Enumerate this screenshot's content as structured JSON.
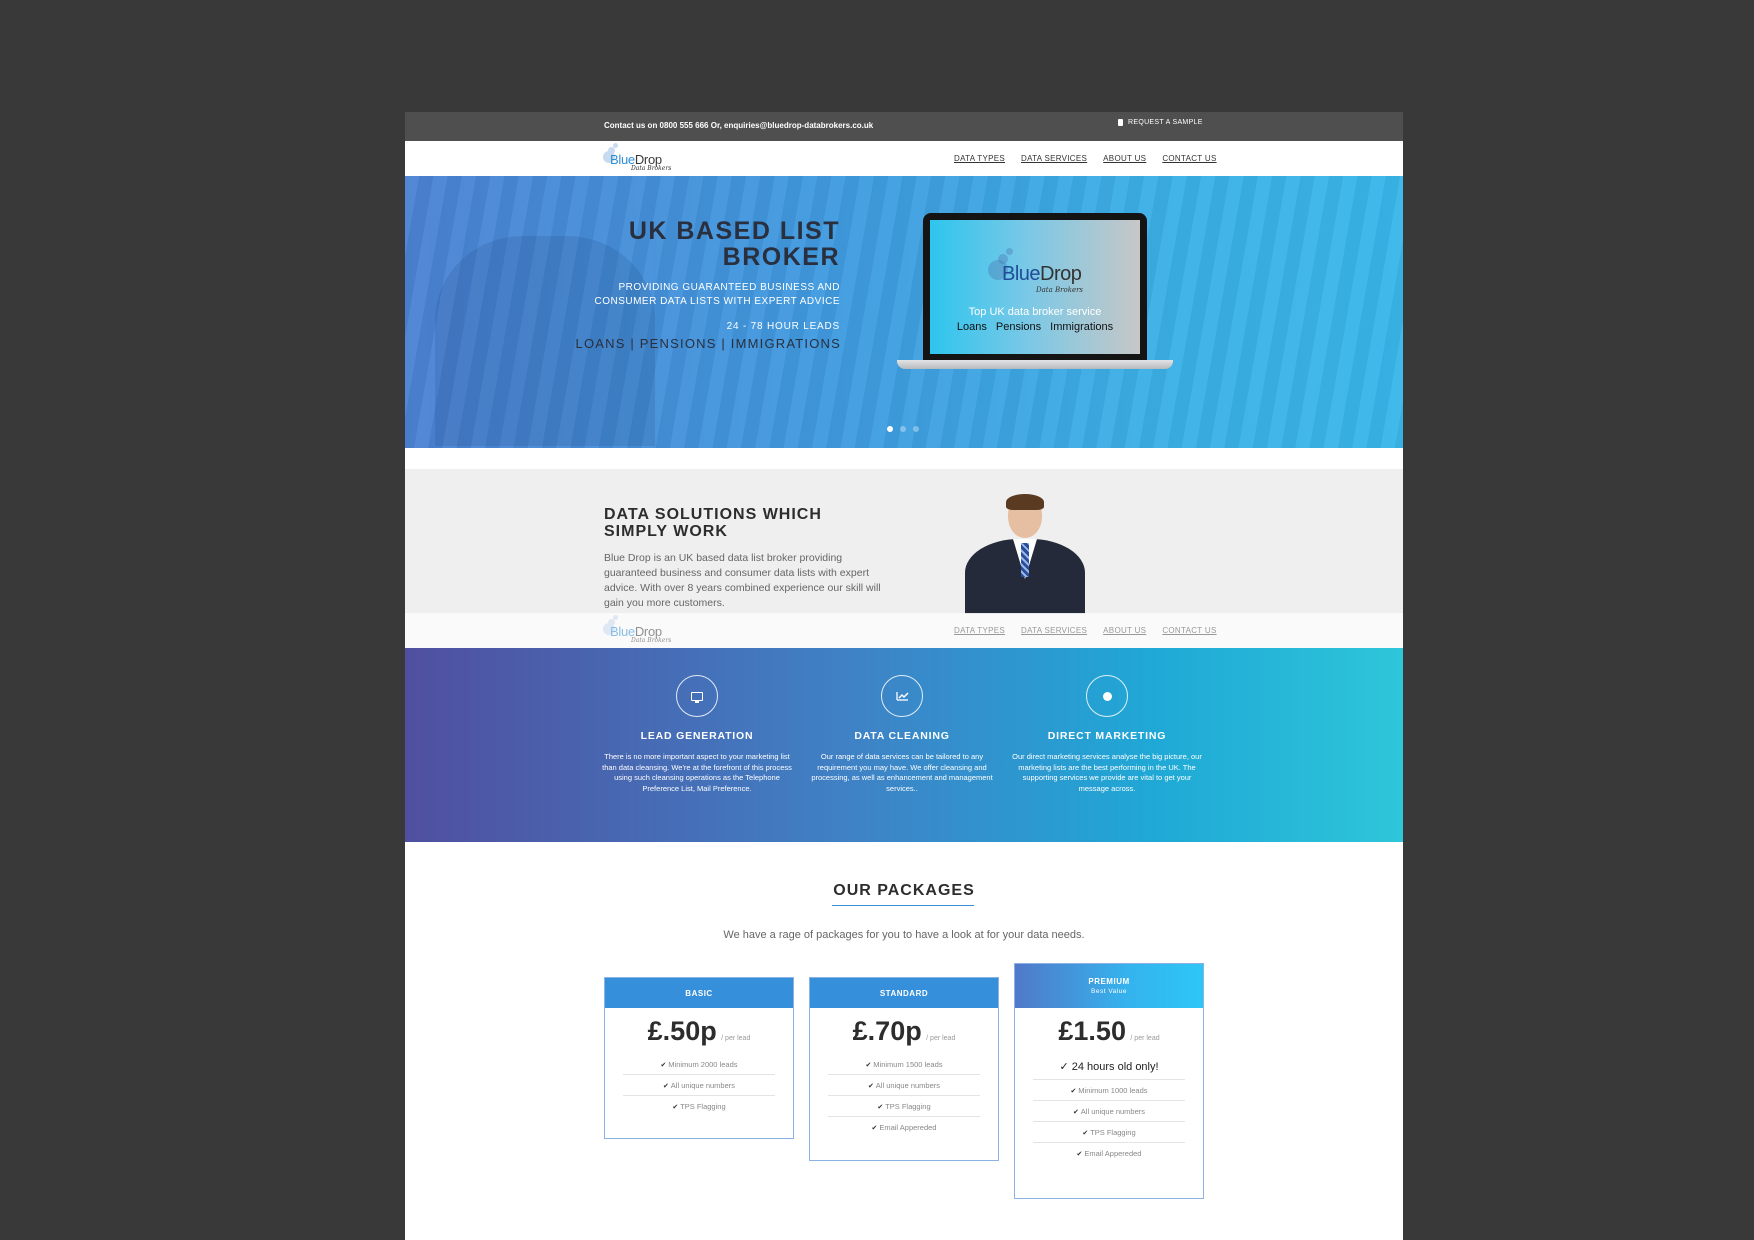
{
  "topbar": {
    "contact": "Contact us on 0800 555 666 Or, enquiries@bluedrop-databrokers.co.uk",
    "sample": "REQUEST A SAMPLE"
  },
  "brand": {
    "blue": "Blue",
    "drop": "Drop",
    "tagline": "Data Brokers"
  },
  "nav": {
    "items": [
      "DATA TYPES",
      "DATA SERVICES",
      "ABOUT US",
      "CONTACT US"
    ]
  },
  "hero": {
    "title": "UK BASED LIST BROKER",
    "subtitle": "PROVIDING GUARANTEED BUSINESS AND CONSUMER DATA LISTS WITH EXPERT ADVICE",
    "leads": "24 - 78 HOUR LEADS",
    "tags": "LOANS | PENSIONS | IMMIGRATIONS",
    "screen_tagline": "Top UK data broker service",
    "screen_products": "Loans  Pensions  Immigrations",
    "slide_count": 3,
    "active_slide": 1
  },
  "about": {
    "title": "DATA SOLUTIONS WHICH SIMPLY WORK",
    "body": "Blue Drop is an UK based data list broker providing guaranteed business and consumer data lists with expert advice. With over 8 years combined experience our skill will gain you more customers."
  },
  "services": [
    {
      "icon": "monitor-icon",
      "title": "LEAD GENERATION",
      "text": "There is no more important aspect to your marketing list than data cleansing. We're at the forefront of this process using such cleansing operations as the Telephone Preference List, Mail Preference."
    },
    {
      "icon": "chart-icon",
      "title": "DATA CLEANING",
      "text": "Our range of data services can be tailored to any requirement you may have. We offer cleansing and processing, as well as enhancement and management services.."
    },
    {
      "icon": "globe-icon",
      "title": "DIRECT MARKETING",
      "text": "Our direct marketing services analyse the big picture, our marketing lists are the best performing in the UK. The supporting services we provide are vital to get your message across."
    }
  ],
  "packages": {
    "title": "OUR PACKAGES",
    "subtitle": "We have a rage of packages for you to have a look at for your data needs.",
    "plans": [
      {
        "name": "BASIC",
        "price": "£.50p",
        "unit": "/ per lead",
        "features": [
          "Minimum 2000 leads",
          "All unique numbers",
          "TPS Flagging"
        ]
      },
      {
        "name": "STANDARD",
        "price": "£.70p",
        "unit": "/ per lead",
        "features": [
          "Minimum 1500 leads",
          "All unique numbers",
          "TPS Flagging",
          "Email Appereded"
        ]
      },
      {
        "name": "PREMIUM",
        "badge": "Best Value",
        "price": "£1.50",
        "unit": "/ per lead",
        "highlight": "24 hours old only!",
        "features": [
          "Minimum 1000 leads",
          "All unique numbers",
          "TPS Flagging",
          "Email Appereded"
        ]
      }
    ]
  },
  "colors": {
    "primary": "#368fda",
    "dark_bar": "#4f4f4f",
    "backdrop": "#383938"
  }
}
